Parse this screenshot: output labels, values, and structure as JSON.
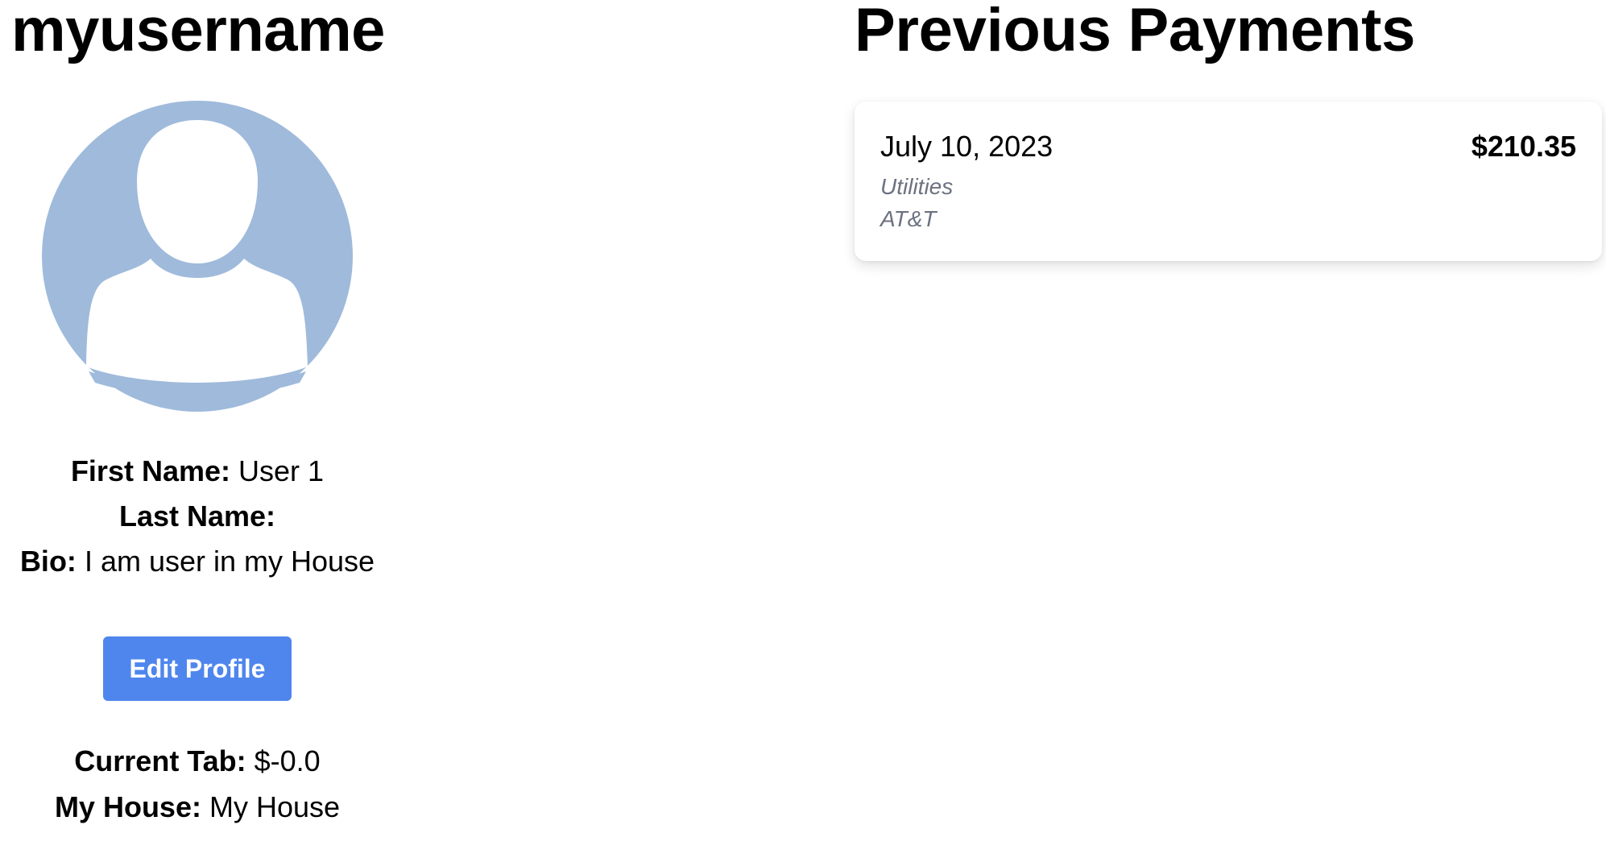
{
  "profile": {
    "username": "myusername",
    "avatar_icon": "default-user-avatar-icon",
    "avatar_color": "#9fbadb",
    "first_name_label": "First Name:",
    "first_name_value": "User 1",
    "last_name_label": "Last Name:",
    "last_name_value": "",
    "bio_label": "Bio:",
    "bio_value": "I am user in my House",
    "edit_button_label": "Edit Profile",
    "current_tab_label": "Current Tab:",
    "current_tab_value": "$-0.0",
    "house_label": "My House:",
    "house_value": "My House"
  },
  "payments": {
    "title": "Previous Payments",
    "items": [
      {
        "date": "July 10, 2023",
        "amount": "$210.35",
        "category": "Utilities",
        "payee": "AT&T"
      }
    ]
  },
  "colors": {
    "accent_button": "#4f86ee",
    "muted_text": "#6b7280"
  }
}
